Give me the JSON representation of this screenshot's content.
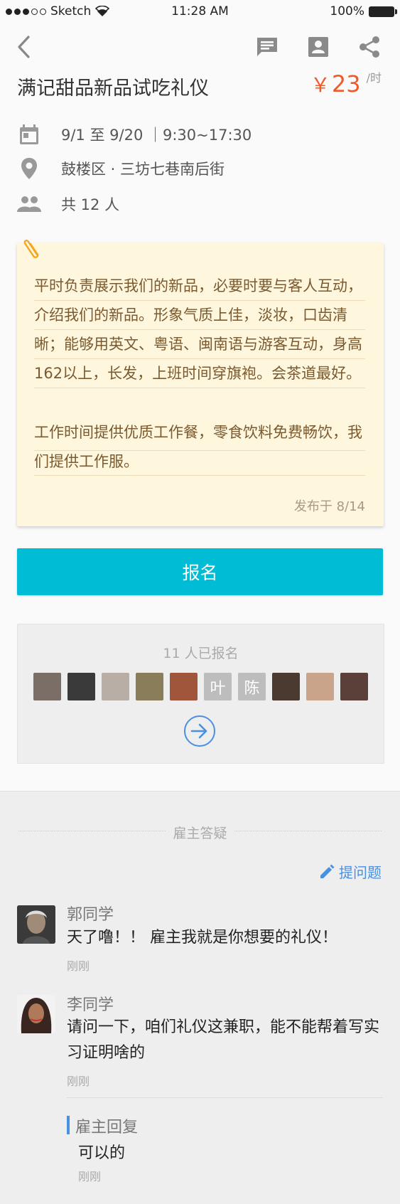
{
  "status_bar": {
    "carrier": "Sketch",
    "time": "11:28 AM",
    "battery": "100%"
  },
  "nav": {
    "icons": [
      "back-icon",
      "chat-icon",
      "contact-icon",
      "share-icon"
    ]
  },
  "job": {
    "title": "满记甜品新品试吃礼仪",
    "price_currency": "￥",
    "price_value": "23",
    "price_unit": "/时",
    "date": "9/1 至 9/20 ｜9:30~17:30",
    "location": "鼓楼区 · 三坊七巷南后街",
    "headcount": "共 12 人"
  },
  "note": {
    "paragraph1": "平时负责展示我们的新品，必要时要与客人互动，介绍我们的新品。形象气质上佳，淡妆，口齿清晰；能够用英文、粤语、闽南语与游客互动，身高162以上，长发，上班时间穿旗袍。会茶道最好。",
    "paragraph2": "工作时间提供优质工作餐，零食饮料免费畅饮，我们提供工作服。",
    "posted": "发布于 8/14"
  },
  "signup_button": "报名",
  "enrolled": {
    "count_label": "11 人已报名",
    "avatars": [
      {
        "text": "",
        "color": "#7a6e66"
      },
      {
        "text": "",
        "color": "#3a3a3a"
      },
      {
        "text": "",
        "color": "#b9aea6"
      },
      {
        "text": "",
        "color": "#8a7d5a"
      },
      {
        "text": "",
        "color": "#a0563a"
      },
      {
        "text": "叶",
        "color": "#bdbdbd"
      },
      {
        "text": "陈",
        "color": "#bdbdbd"
      },
      {
        "text": "",
        "color": "#4a3a30"
      },
      {
        "text": "",
        "color": "#c9a48a"
      },
      {
        "text": "",
        "color": "#5a4038"
      }
    ]
  },
  "qa": {
    "section_title": "雇主答疑",
    "ask_label": "提问题",
    "questions": [
      {
        "name": "郭同学",
        "text": "天了噜！！ 雇主我就是你想要的礼仪！",
        "time": "刚刚"
      },
      {
        "name": "李同学",
        "text": "请问一下，咱们礼仪这兼职，能不能帮着写实习证明啥的",
        "time": "刚刚",
        "reply_label": "雇主回复",
        "reply_text": "可以的",
        "reply_time": "刚刚"
      }
    ]
  },
  "colors": {
    "accent_cyan": "#00bcd4",
    "price_orange": "#f05a28",
    "link_blue": "#4a90e2",
    "note_bg": "#fff6de"
  }
}
